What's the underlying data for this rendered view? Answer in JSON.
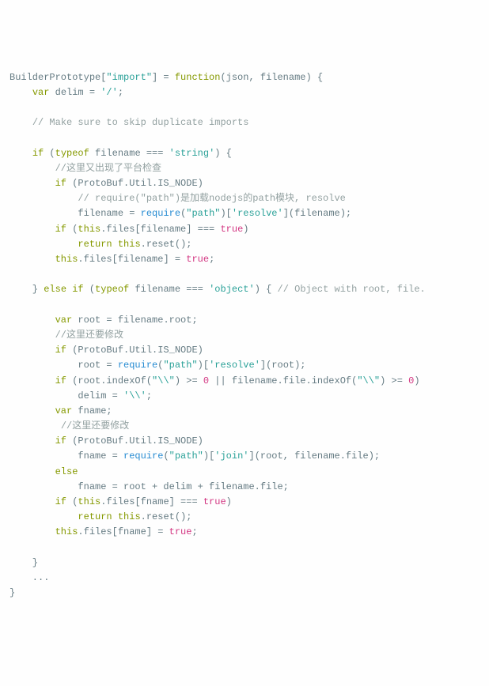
{
  "code": {
    "tokens": [
      [
        [
          "BuilderPrototype[",
          "t-default"
        ],
        [
          "\"import\"",
          "t-string"
        ],
        [
          "] = ",
          "t-default"
        ],
        [
          "function",
          "t-keyword"
        ],
        [
          "(json, filename) {",
          "t-default"
        ]
      ],
      [
        [
          "    ",
          "t-default"
        ],
        [
          "var",
          "t-keyword"
        ],
        [
          " delim = ",
          "t-default"
        ],
        [
          "'/'",
          "t-string"
        ],
        [
          ";",
          "t-default"
        ]
      ],
      [
        [
          "",
          "t-default"
        ]
      ],
      [
        [
          "    ",
          "t-default"
        ],
        [
          "// Make sure to skip duplicate imports",
          "t-comment"
        ]
      ],
      [
        [
          "",
          "t-default"
        ]
      ],
      [
        [
          "    ",
          "t-default"
        ],
        [
          "if",
          "t-keyword"
        ],
        [
          " (",
          "t-default"
        ],
        [
          "typeof",
          "t-keyword"
        ],
        [
          " filename === ",
          "t-default"
        ],
        [
          "'string'",
          "t-string"
        ],
        [
          ") {",
          "t-default"
        ]
      ],
      [
        [
          "        ",
          "t-default"
        ],
        [
          "//这里又出现了平台检查",
          "t-comment"
        ]
      ],
      [
        [
          "        ",
          "t-default"
        ],
        [
          "if",
          "t-keyword"
        ],
        [
          " (ProtoBuf.Util.IS_NODE)",
          "t-default"
        ]
      ],
      [
        [
          "            ",
          "t-default"
        ],
        [
          "// require(\"path\")是加载nodejs的path模块, resolve",
          "t-comment"
        ]
      ],
      [
        [
          "            filename = ",
          "t-default"
        ],
        [
          "require",
          "t-builtin"
        ],
        [
          "(",
          "t-default"
        ],
        [
          "\"path\"",
          "t-string"
        ],
        [
          ")[",
          "t-default"
        ],
        [
          "'resolve'",
          "t-string"
        ],
        [
          "](filename);",
          "t-default"
        ]
      ],
      [
        [
          "        ",
          "t-default"
        ],
        [
          "if",
          "t-keyword"
        ],
        [
          " (",
          "t-default"
        ],
        [
          "this",
          "t-keyword"
        ],
        [
          ".files[filename] === ",
          "t-default"
        ],
        [
          "true",
          "t-number"
        ],
        [
          ")",
          "t-default"
        ]
      ],
      [
        [
          "            ",
          "t-default"
        ],
        [
          "return",
          "t-keyword"
        ],
        [
          " ",
          "t-default"
        ],
        [
          "this",
          "t-keyword"
        ],
        [
          ".reset();",
          "t-default"
        ]
      ],
      [
        [
          "        ",
          "t-default"
        ],
        [
          "this",
          "t-keyword"
        ],
        [
          ".files[filename] = ",
          "t-default"
        ],
        [
          "true",
          "t-number"
        ],
        [
          ";",
          "t-default"
        ]
      ],
      [
        [
          "",
          "t-default"
        ]
      ],
      [
        [
          "    } ",
          "t-default"
        ],
        [
          "else",
          "t-keyword"
        ],
        [
          " ",
          "t-default"
        ],
        [
          "if",
          "t-keyword"
        ],
        [
          " (",
          "t-default"
        ],
        [
          "typeof",
          "t-keyword"
        ],
        [
          " filename === ",
          "t-default"
        ],
        [
          "'object'",
          "t-string"
        ],
        [
          ") { ",
          "t-default"
        ],
        [
          "// Object with root, file.",
          "t-comment"
        ]
      ],
      [
        [
          "",
          "t-default"
        ]
      ],
      [
        [
          "        ",
          "t-default"
        ],
        [
          "var",
          "t-keyword"
        ],
        [
          " root = filename.root;",
          "t-default"
        ]
      ],
      [
        [
          "        ",
          "t-default"
        ],
        [
          "//这里还要修改",
          "t-comment"
        ]
      ],
      [
        [
          "        ",
          "t-default"
        ],
        [
          "if",
          "t-keyword"
        ],
        [
          " (ProtoBuf.Util.IS_NODE)",
          "t-default"
        ]
      ],
      [
        [
          "            root = ",
          "t-default"
        ],
        [
          "require",
          "t-builtin"
        ],
        [
          "(",
          "t-default"
        ],
        [
          "\"path\"",
          "t-string"
        ],
        [
          ")[",
          "t-default"
        ],
        [
          "'resolve'",
          "t-string"
        ],
        [
          "](root);",
          "t-default"
        ]
      ],
      [
        [
          "        ",
          "t-default"
        ],
        [
          "if",
          "t-keyword"
        ],
        [
          " (root.indexOf(",
          "t-default"
        ],
        [
          "\"\\\\\"",
          "t-string"
        ],
        [
          ") >= ",
          "t-default"
        ],
        [
          "0",
          "t-number"
        ],
        [
          " || filename.file.indexOf(",
          "t-default"
        ],
        [
          "\"\\\\\"",
          "t-string"
        ],
        [
          ") >= ",
          "t-default"
        ],
        [
          "0",
          "t-number"
        ],
        [
          ")",
          "t-default"
        ]
      ],
      [
        [
          "            delim = ",
          "t-default"
        ],
        [
          "'\\\\'",
          "t-string"
        ],
        [
          ";",
          "t-default"
        ]
      ],
      [
        [
          "        ",
          "t-default"
        ],
        [
          "var",
          "t-keyword"
        ],
        [
          " fname;",
          "t-default"
        ]
      ],
      [
        [
          "         ",
          "t-default"
        ],
        [
          "//这里还要修改",
          "t-comment"
        ]
      ],
      [
        [
          "        ",
          "t-default"
        ],
        [
          "if",
          "t-keyword"
        ],
        [
          " (ProtoBuf.Util.IS_NODE)",
          "t-default"
        ]
      ],
      [
        [
          "            fname = ",
          "t-default"
        ],
        [
          "require",
          "t-builtin"
        ],
        [
          "(",
          "t-default"
        ],
        [
          "\"path\"",
          "t-string"
        ],
        [
          ")[",
          "t-default"
        ],
        [
          "'join'",
          "t-string"
        ],
        [
          "](root, filename.file);",
          "t-default"
        ]
      ],
      [
        [
          "        ",
          "t-default"
        ],
        [
          "else",
          "t-keyword"
        ]
      ],
      [
        [
          "            fname = root + delim + filename.file;",
          "t-default"
        ]
      ],
      [
        [
          "        ",
          "t-default"
        ],
        [
          "if",
          "t-keyword"
        ],
        [
          " (",
          "t-default"
        ],
        [
          "this",
          "t-keyword"
        ],
        [
          ".files[fname] === ",
          "t-default"
        ],
        [
          "true",
          "t-number"
        ],
        [
          ")",
          "t-default"
        ]
      ],
      [
        [
          "            ",
          "t-default"
        ],
        [
          "return",
          "t-keyword"
        ],
        [
          " ",
          "t-default"
        ],
        [
          "this",
          "t-keyword"
        ],
        [
          ".reset();",
          "t-default"
        ]
      ],
      [
        [
          "        ",
          "t-default"
        ],
        [
          "this",
          "t-keyword"
        ],
        [
          ".files[fname] = ",
          "t-default"
        ],
        [
          "true",
          "t-number"
        ],
        [
          ";",
          "t-default"
        ]
      ],
      [
        [
          "",
          "t-default"
        ]
      ],
      [
        [
          "    }",
          "t-default"
        ]
      ],
      [
        [
          "    ...",
          "t-default"
        ]
      ],
      [
        [
          "}",
          "t-default"
        ]
      ]
    ]
  }
}
